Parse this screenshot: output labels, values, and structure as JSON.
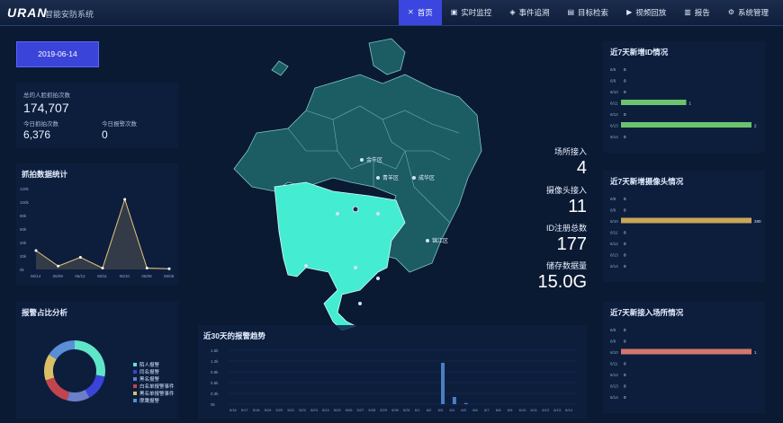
{
  "app": {
    "logo": "URAN",
    "title": "智能安防系统"
  },
  "nav": [
    {
      "label": "首页",
      "icon": "close-icon",
      "glyph": "✕",
      "active": true
    },
    {
      "label": "实时监控",
      "icon": "monitor-icon",
      "glyph": "▣"
    },
    {
      "label": "事件追溯",
      "icon": "trace-icon",
      "glyph": "◈"
    },
    {
      "label": "目标检索",
      "icon": "search-icon",
      "glyph": "▤"
    },
    {
      "label": "视频回放",
      "icon": "play-icon",
      "glyph": "▶"
    },
    {
      "label": "报告",
      "icon": "report-icon",
      "glyph": "▥"
    },
    {
      "label": "系统管理",
      "icon": "gear-icon",
      "glyph": "⚙"
    }
  ],
  "date": "2019-06-14",
  "stats": {
    "total_label": "总的人脸抓拍次数",
    "total_value": "174,707",
    "today_label": "今日抓拍次数",
    "today_value": "6,376",
    "alarm_label": "今日报警次数",
    "alarm_value": "0"
  },
  "capture_chart_title": "抓拍数据统计",
  "alarm_pie_title": "报警占比分析",
  "trend_title": "近30天的报警趋势",
  "map": {
    "places": [
      "金牛区",
      "青羊区",
      "成华区",
      "锦江区"
    ]
  },
  "summary": [
    {
      "label": "场所接入",
      "value": "4"
    },
    {
      "label": "摄像头接入",
      "value": "11"
    },
    {
      "label": "ID注册总数",
      "value": "177"
    },
    {
      "label": "储存数据量",
      "value": "15.0G"
    }
  ],
  "right_panels": [
    {
      "title": "近7天新增ID情况",
      "bar_color": "#6cc36e",
      "rows": [
        {
          "label": "6/8",
          "value": 0
        },
        {
          "label": "6/9",
          "value": 0
        },
        {
          "label": "6/10",
          "value": 0
        },
        {
          "label": "6/11",
          "value": 1
        },
        {
          "label": "6/12",
          "value": 0
        },
        {
          "label": "6/13",
          "value": 2
        },
        {
          "label": "6/14",
          "value": 0
        }
      ],
      "max": 2
    },
    {
      "title": "近7天新增摄像头情况",
      "bar_color": "#c9a65a",
      "rows": [
        {
          "label": "6/8",
          "value": 0
        },
        {
          "label": "6/9",
          "value": 0
        },
        {
          "label": "6/10",
          "value": 280
        },
        {
          "label": "6/11",
          "value": 0
        },
        {
          "label": "6/12",
          "value": 0
        },
        {
          "label": "6/13",
          "value": 0
        },
        {
          "label": "6/14",
          "value": 0
        }
      ],
      "max": 280
    },
    {
      "title": "近7天新接入场所情况",
      "bar_color": "#d2776c",
      "rows": [
        {
          "label": "6/8",
          "value": 0
        },
        {
          "label": "6/9",
          "value": 0
        },
        {
          "label": "6/10",
          "value": 1
        },
        {
          "label": "6/11",
          "value": 0
        },
        {
          "label": "6/12",
          "value": 0
        },
        {
          "label": "6/13",
          "value": 0
        },
        {
          "label": "6/14",
          "value": 0
        }
      ],
      "max": 1
    }
  ],
  "chart_data": [
    {
      "type": "line",
      "categories": [
        "06/08",
        "06/09",
        "06/10",
        "06/11",
        "06/12",
        "06/13",
        "06/14"
      ],
      "values": [
        28000,
        5000,
        18000,
        2000,
        104000,
        2000,
        1000
      ],
      "ylim": [
        0,
        120000
      ],
      "yticks": [
        "0k",
        "20k",
        "40k",
        "60k",
        "80k",
        "100k",
        "120k"
      ],
      "xticks": [
        "06/14",
        "06/09",
        "06/12",
        "06/11",
        "06/10",
        "06/09",
        "06/08"
      ],
      "color": "#e6c37a"
    },
    {
      "type": "pie",
      "legend": [
        "陌人报警",
        "同名报警",
        "黑名报警",
        "白名单报警事件",
        "黑名单报警事件",
        "摩鹰报警"
      ],
      "values": [
        28,
        14,
        12,
        16,
        14,
        16
      ],
      "colors": [
        "#5fe6c8",
        "#3a44d8",
        "#6b7ec9",
        "#c2454e",
        "#d9c066",
        "#5a8ed6"
      ]
    },
    {
      "type": "bar",
      "categories": [
        "5/16",
        "5/17",
        "5/18",
        "5/19",
        "5/20",
        "5/21",
        "5/22",
        "5/23",
        "5/24",
        "5/25",
        "5/26",
        "5/27",
        "5/28",
        "5/29",
        "5/30",
        "5/31",
        "6/1",
        "6/2",
        "6/3",
        "6/4",
        "6/5",
        "6/6",
        "6/7",
        "6/8",
        "6/9",
        "6/10",
        "6/11",
        "6/12",
        "6/13",
        "6/14"
      ],
      "values": [
        0,
        0,
        0,
        0,
        0,
        0,
        0,
        0,
        0,
        0,
        0,
        0,
        0,
        0,
        0,
        0,
        0,
        0,
        1150,
        200,
        30,
        0,
        0,
        0,
        0,
        0,
        0,
        0,
        0,
        0
      ],
      "ylim": [
        0,
        1500
      ],
      "yticks": [
        "0k",
        "0.3k",
        "0.6k",
        "0.9k",
        "1.2k",
        "1.5k"
      ]
    }
  ]
}
